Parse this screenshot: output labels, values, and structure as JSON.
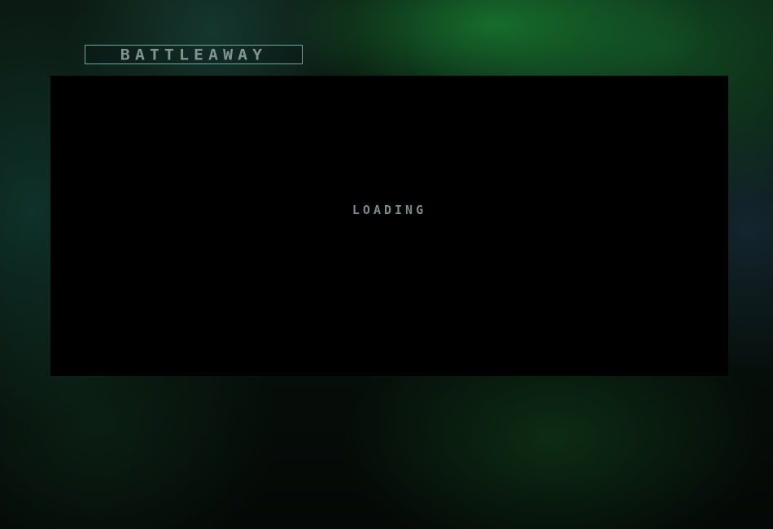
{
  "header": {
    "logo_text": "BATTLEAWAY"
  },
  "game": {
    "status_text": "LOADING"
  },
  "colors": {
    "logo_border": "#6fa7a0",
    "logo_text": "#7f9491",
    "viewport_background": "#000000",
    "status_text": "#7c8a8a",
    "background_accent": "#187830"
  }
}
